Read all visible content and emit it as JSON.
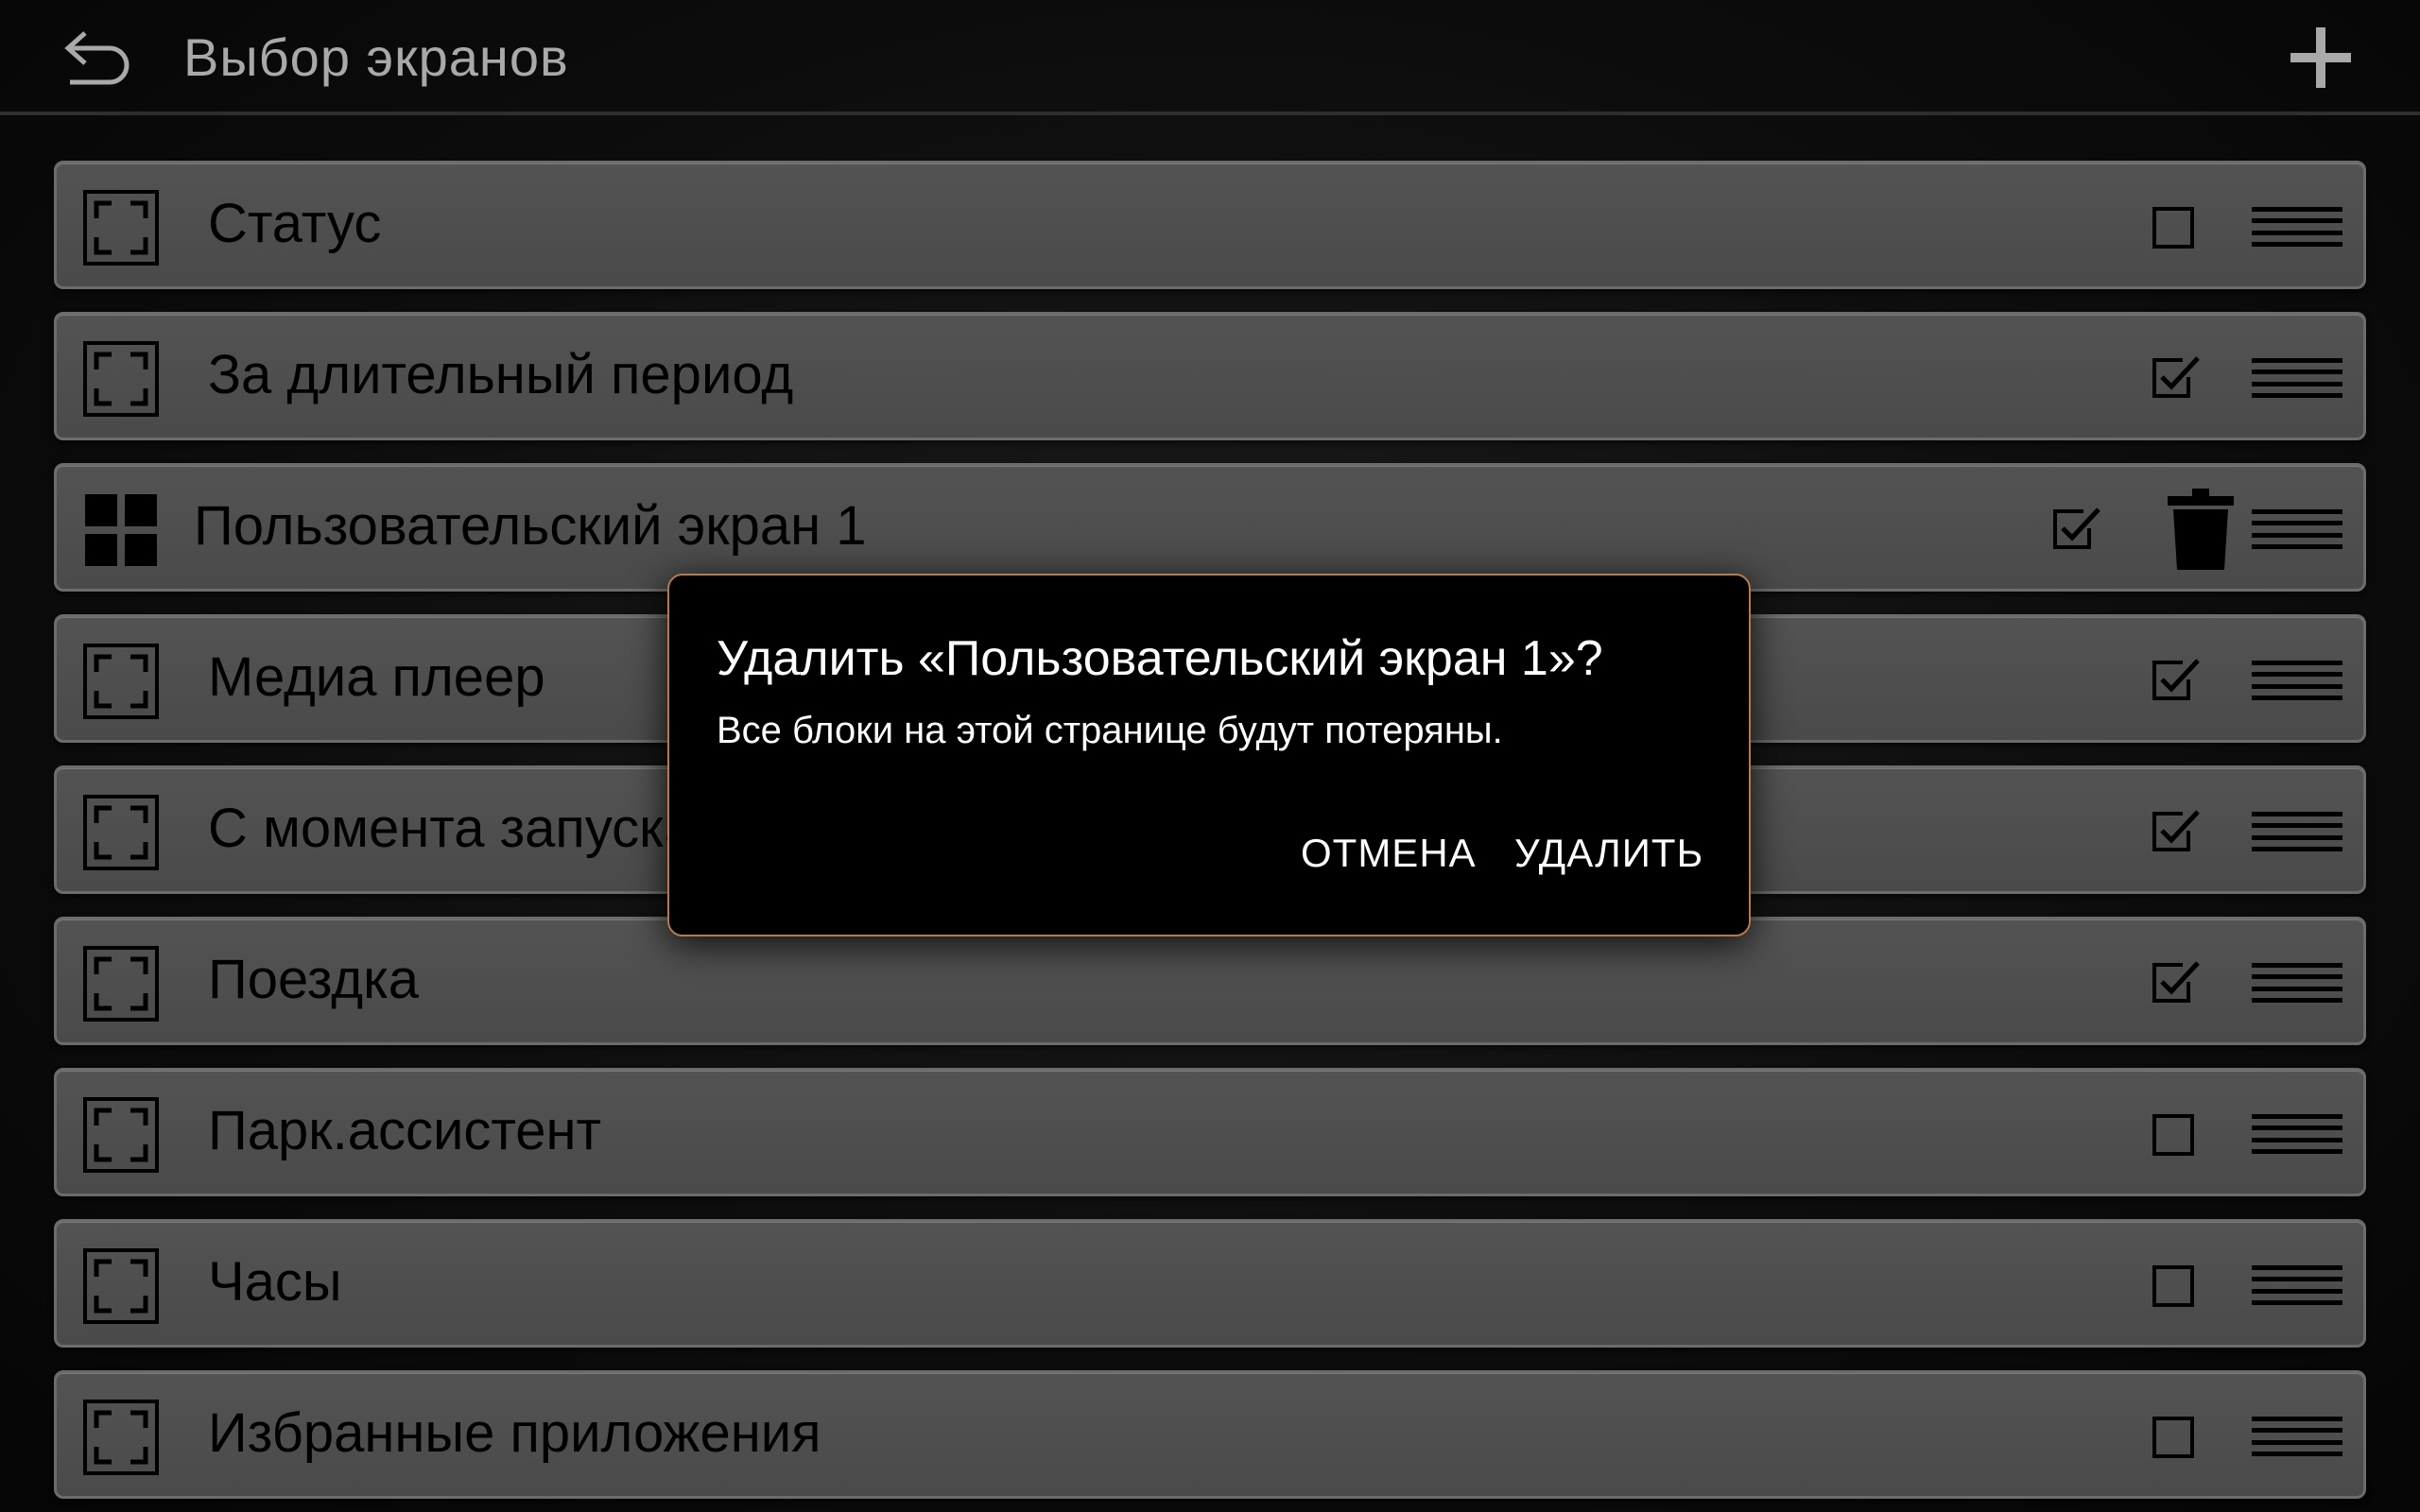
{
  "header": {
    "title": "Выбор экранов",
    "back_icon": "back-arrow-icon",
    "add_icon": "plus-icon"
  },
  "screens": [
    {
      "label": "Статус",
      "icon": "frame-icon",
      "checked": false,
      "deletable": false
    },
    {
      "label": "За длительный период",
      "icon": "frame-icon",
      "checked": true,
      "deletable": false
    },
    {
      "label": "Пользовательский экран 1",
      "icon": "grid-icon",
      "checked": true,
      "deletable": true
    },
    {
      "label": "Медиа плеер",
      "icon": "frame-icon",
      "checked": true,
      "deletable": false
    },
    {
      "label": "С момента запуска",
      "icon": "frame-icon",
      "checked": true,
      "deletable": false
    },
    {
      "label": "Поездка",
      "icon": "frame-icon",
      "checked": true,
      "deletable": false
    },
    {
      "label": "Парк.ассистент",
      "icon": "frame-icon",
      "checked": false,
      "deletable": false
    },
    {
      "label": "Часы",
      "icon": "frame-icon",
      "checked": false,
      "deletable": false
    },
    {
      "label": "Избранные приложения",
      "icon": "frame-icon",
      "checked": false,
      "deletable": false
    }
  ],
  "dialog": {
    "title": "Удалить «Пользовательский экран 1»?",
    "message": "Все блоки на этой странице будут потеряны.",
    "cancel_label": "ОТМЕНА",
    "delete_label": "УДАЛИТЬ"
  },
  "colors": {
    "accent_border": "#b77a4b",
    "row_background": "#4f4f4f",
    "title_text": "#a9a9a9"
  }
}
